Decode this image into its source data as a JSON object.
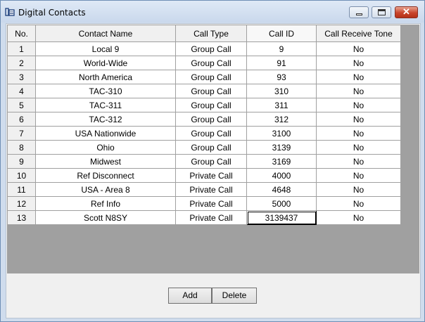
{
  "window": {
    "title": "Digital Contacts"
  },
  "table": {
    "columns": [
      "No.",
      "Contact Name",
      "Call Type",
      "Call ID",
      "Call Receive Tone"
    ],
    "rows": [
      [
        "1",
        "Local 9",
        "Group Call",
        "9",
        "No"
      ],
      [
        "2",
        "World-Wide",
        "Group Call",
        "91",
        "No"
      ],
      [
        "3",
        "North America",
        "Group Call",
        "93",
        "No"
      ],
      [
        "4",
        "TAC-310",
        "Group Call",
        "310",
        "No"
      ],
      [
        "5",
        "TAC-311",
        "Group Call",
        "311",
        "No"
      ],
      [
        "6",
        "TAC-312",
        "Group Call",
        "312",
        "No"
      ],
      [
        "7",
        "USA Nationwide",
        "Group Call",
        "3100",
        "No"
      ],
      [
        "8",
        "Ohio",
        "Group Call",
        "3139",
        "No"
      ],
      [
        "9",
        "Midwest",
        "Group Call",
        "3169",
        "No"
      ],
      [
        "10",
        "Ref Disconnect",
        "Private Call",
        "4000",
        "No"
      ],
      [
        "11",
        "USA - Area 8",
        "Private Call",
        "4648",
        "No"
      ],
      [
        "12",
        "Ref Info",
        "Private Call",
        "5000",
        "No"
      ],
      [
        "13",
        "Scott N8SY",
        "Private Call",
        "3139437",
        "No"
      ]
    ],
    "selected": {
      "row": 12,
      "col": 3
    }
  },
  "buttons": {
    "add": "Add",
    "delete": "Delete"
  },
  "icons": {
    "app": "contacts-app-icon",
    "minimize": "minimize-icon",
    "maximize": "maximize-icon",
    "close": "close-icon"
  }
}
